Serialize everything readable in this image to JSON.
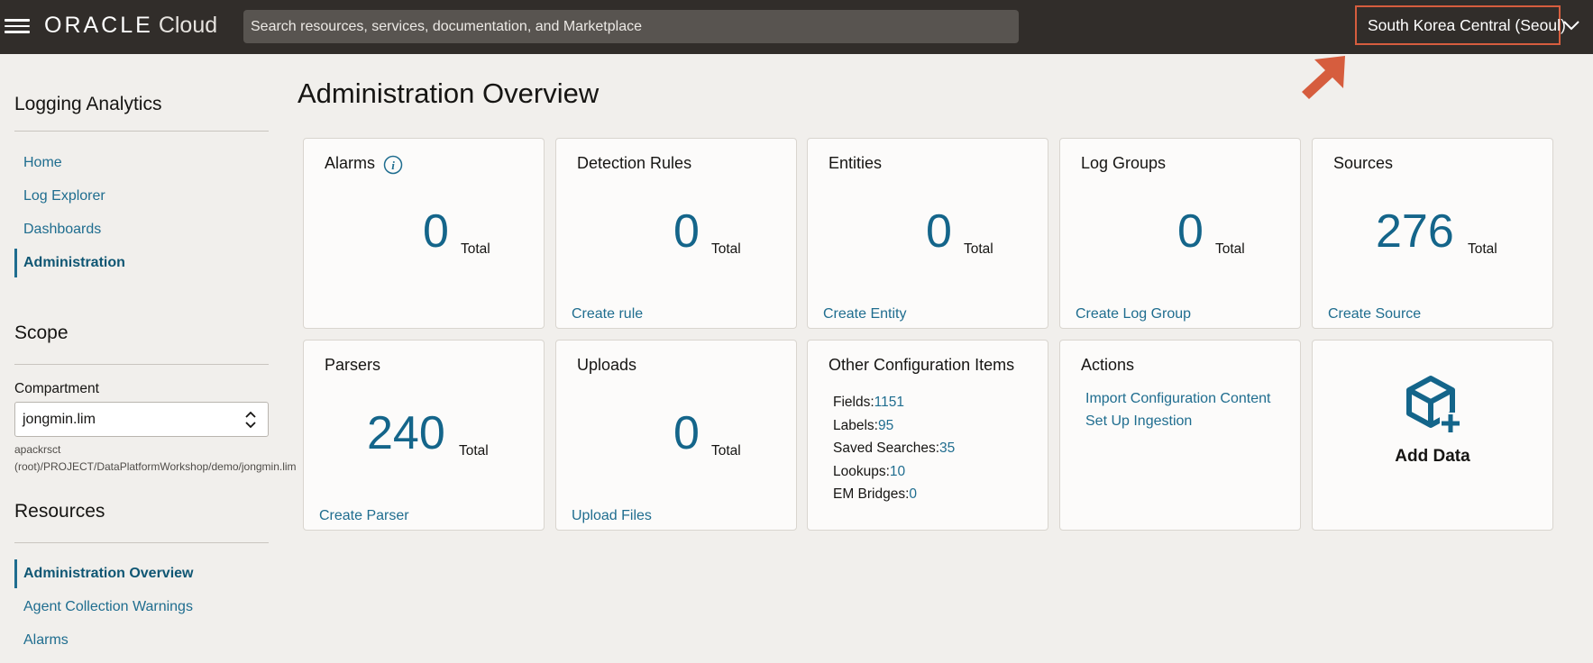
{
  "header": {
    "logo_brand": "ORACLE",
    "logo_product": "Cloud",
    "search_placeholder": "Search resources, services, documentation, and Marketplace",
    "region": "South Korea Central (Seoul)",
    "annotation_color": "#d65d3e"
  },
  "sidebar": {
    "title": "Logging Analytics",
    "nav": [
      {
        "label": "Home",
        "active": false
      },
      {
        "label": "Log Explorer",
        "active": false
      },
      {
        "label": "Dashboards",
        "active": false
      },
      {
        "label": "Administration",
        "active": true
      }
    ],
    "scope": {
      "title": "Scope",
      "compartment_label": "Compartment",
      "compartment_value": "jongmin.lim",
      "compartment_path": "apackrsct (root)/PROJECT/DataPlatformWorkshop/demo/jongmin.lim"
    },
    "resources": {
      "title": "Resources",
      "items": [
        {
          "label": "Administration Overview",
          "active": true
        },
        {
          "label": "Agent Collection Warnings",
          "active": false
        },
        {
          "label": "Alarms",
          "active": false
        }
      ]
    }
  },
  "main": {
    "title": "Administration Overview",
    "total_label": "Total",
    "cards": [
      {
        "title": "Alarms",
        "value": "0",
        "link": ""
      },
      {
        "title": "Detection Rules",
        "value": "0",
        "link": "Create rule"
      },
      {
        "title": "Entities",
        "value": "0",
        "link": "Create Entity"
      },
      {
        "title": "Log Groups",
        "value": "0",
        "link": "Create Log Group"
      },
      {
        "title": "Sources",
        "value": "276",
        "link": "Create Source"
      },
      {
        "title": "Parsers",
        "value": "240",
        "link": "Create Parser"
      },
      {
        "title": "Uploads",
        "value": "0",
        "link": "Upload Files"
      }
    ],
    "other_config": {
      "title": "Other Configuration Items",
      "items": [
        {
          "label": "Fields:",
          "value": "1151"
        },
        {
          "label": "Labels:",
          "value": "95"
        },
        {
          "label": "Saved Searches:",
          "value": "35"
        },
        {
          "label": "Lookups:",
          "value": "10"
        },
        {
          "label": "EM Bridges:",
          "value": "0"
        }
      ]
    },
    "actions": {
      "title": "Actions",
      "links": [
        "Import Configuration Content",
        "Set Up Ingestion"
      ]
    },
    "add_data": {
      "label": "Add Data"
    },
    "accent_color": "#14658a"
  }
}
